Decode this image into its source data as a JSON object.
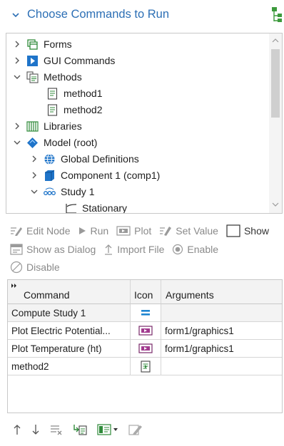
{
  "header": {
    "title": "Choose Commands to Run"
  },
  "tree": {
    "items": [
      {
        "label": "Forms",
        "icon": "forms-icon",
        "expander": "collapsed"
      },
      {
        "label": "GUI Commands",
        "icon": "gui-commands-icon",
        "expander": "collapsed"
      },
      {
        "label": "Methods",
        "icon": "methods-icon",
        "expander": "expanded"
      },
      {
        "label": "method1",
        "icon": "method-icon",
        "expander": "none"
      },
      {
        "label": "method2",
        "icon": "method-icon",
        "expander": "none"
      },
      {
        "label": "Libraries",
        "icon": "libraries-icon",
        "expander": "collapsed"
      },
      {
        "label": "Model (root)",
        "icon": "model-icon",
        "expander": "expanded"
      },
      {
        "label": "Global Definitions",
        "icon": "global-definitions-icon",
        "expander": "collapsed"
      },
      {
        "label": "Component 1 (comp1)",
        "icon": "component-icon",
        "expander": "collapsed"
      },
      {
        "label": "Study 1",
        "icon": "study-icon",
        "expander": "expanded"
      },
      {
        "label": "Stationary",
        "icon": "stationary-icon",
        "expander": "none"
      }
    ]
  },
  "toolbar": {
    "edit_node": "Edit Node",
    "run": "Run",
    "plot": "Plot",
    "set_value": "Set Value",
    "show": "Show",
    "show_as_dialog": "Show as Dialog",
    "import_file": "Import File",
    "enable": "Enable",
    "disable": "Disable"
  },
  "table": {
    "headers": {
      "command": "Command",
      "icon": "Icon",
      "arguments": "Arguments"
    },
    "rows": [
      {
        "command": "Compute Study 1",
        "icon": "compute-icon",
        "arguments": ""
      },
      {
        "command": "Plot Electric Potential...",
        "icon": "plot-icon",
        "arguments": "form1/graphics1"
      },
      {
        "command": "Plot Temperature (ht)",
        "icon": "plot-icon",
        "arguments": "form1/graphics1"
      },
      {
        "command": "method2",
        "icon": "method-icon",
        "arguments": ""
      }
    ]
  },
  "bottom_toolbar": [
    "move-up-icon",
    "move-down-icon",
    "delete-icon",
    "add-command-icon",
    "add-menu-icon",
    "edit-icon"
  ]
}
